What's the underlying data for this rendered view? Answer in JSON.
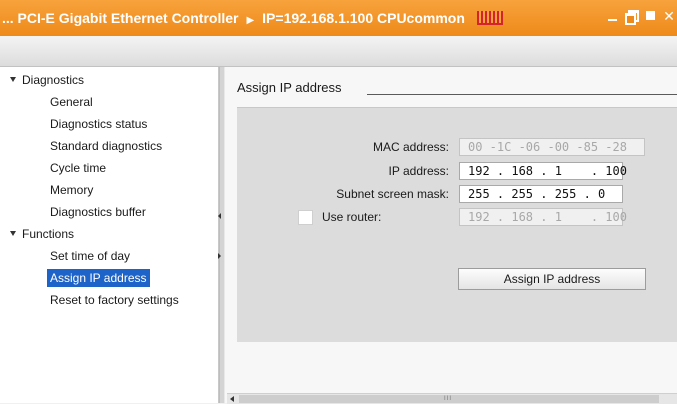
{
  "titlebar": {
    "device": "... PCI-E Gigabit Ethernet Controller",
    "separator": "▶",
    "target": "IP=192.168.1.100 CPUcommon",
    "accent_color": "#ee8a1a",
    "stripe_color": "#d4232a"
  },
  "nav": {
    "diagnostics": {
      "label": "Diagnostics",
      "items": [
        "General",
        "Diagnostics status",
        "Standard diagnostics",
        "Cycle time",
        "Memory",
        "Diagnostics buffer"
      ]
    },
    "functions": {
      "label": "Functions",
      "items": [
        "Set time of day",
        "Assign IP address",
        "Reset to factory settings"
      ],
      "selected": "Assign IP address"
    },
    "selection_color": "#1e63c8"
  },
  "main": {
    "section_title": "Assign IP address",
    "mac": {
      "label": "MAC address:",
      "value": "00 -1C -06 -00 -85 -28"
    },
    "ip": {
      "label": "IP address:",
      "value": "192 . 168 . 1    . 100"
    },
    "subnet": {
      "label": "Subnet screen mask:",
      "value": "255 . 255 . 255 . 0"
    },
    "router": {
      "label": "Use router:",
      "checked": false,
      "value": "192 . 168 . 1    . 100"
    },
    "assign_button": "Assign IP address",
    "scroll_grip": "III"
  }
}
